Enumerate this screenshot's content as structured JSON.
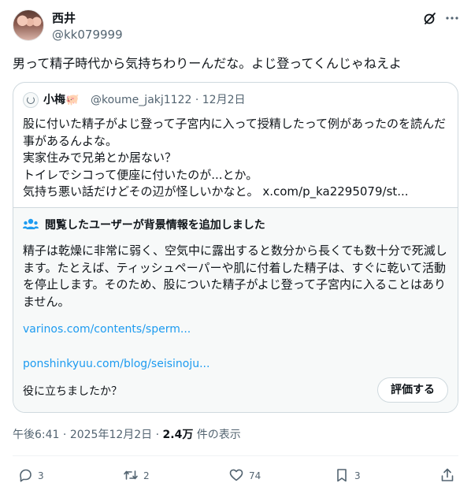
{
  "author": {
    "display_name": "西井",
    "handle": "@kk079999"
  },
  "tweet": {
    "text": "男って精子時代から気持ちわりーんだな。よじ登ってくんじゃねえよ"
  },
  "quote": {
    "display_name": "小梅🐖",
    "handle": "@koume_jakj1122",
    "date": "12月2日",
    "text": "股に付いた精子がよじ登って子宮内に入って授精したって例があったのを読んだ事があるんよな。\n実家住みで兄弟とか居ない？\nトイレでシコって便座に付いたのが...とか。\n気持ち悪い話だけどその辺が怪しいかなと。",
    "link": "x.com/p_ka2295079/st..."
  },
  "community_note": {
    "title": "閲覧したユーザーが背景情報を追加しました",
    "body": "精子は乾燥に非常に弱く、空気中に露出すると数分から長くても数十分で死滅します。たとえば、ティッシュペーパーや肌に付着した精子は、すぐに乾いて活動を停止します。そのため、股についた精子がよじ登って子宮内に入ることはありません。",
    "links": [
      "varinos.com/contents/sperm...",
      "ponshinkyuu.com/blog/seisinoju..."
    ],
    "helpful_question": "役に立ちましたか？",
    "rate_button": "評価する"
  },
  "meta": {
    "time": "午後6:41",
    "date": "2025年12月2日",
    "views_count": "2.4万",
    "views_label": "件の表示"
  },
  "actions": {
    "replies": "3",
    "reposts": "2",
    "likes": "74",
    "bookmarks": "3"
  },
  "icons": {
    "grok": "grok-icon",
    "more": "more-icon",
    "reply": "reply-icon",
    "repost": "repost-icon",
    "like": "heart-icon",
    "bookmark": "bookmark-icon",
    "share": "share-icon",
    "note": "community-notes-icon"
  },
  "colors": {
    "text": "#0f1419",
    "secondary": "#536471",
    "link": "#1d9bf0",
    "border": "#cfd9de",
    "note_bg": "#f7f9f9"
  }
}
